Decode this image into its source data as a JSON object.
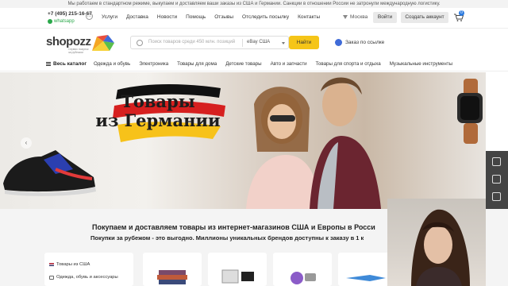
{
  "notice": "Мы работаем в стандартном режиме, выкупаем и доставляем ваши заказы из США и Германии. Санкции в отношении России не затронули международную логистику.",
  "contacts": {
    "phone": "+7 (495) 215-16-67",
    "whatsapp": "whatsapp"
  },
  "topnav": {
    "items": [
      "Услуги",
      "Доставка",
      "Новости",
      "Помощь",
      "Отзывы",
      "Отследить посылку",
      "Контакты"
    ],
    "location": "Москва",
    "login": "Войти",
    "register": "Создать аккаунт",
    "cart_count": "0"
  },
  "header": {
    "logo": "shopozz",
    "tagline": "Сервис покупок за рубежом",
    "search_placeholder": "Поиск товаров среди 450 млн. позиций",
    "search_source": "eBay США",
    "search_button": "Найти",
    "order_link": "Заказ по ссылке"
  },
  "catbar": {
    "all": "Весь каталог",
    "items": [
      "Одежда и обувь",
      "Электроника",
      "Товары для дома",
      "Детские товары",
      "Авто и запчасти",
      "Товары для спорта и отдыха",
      "Музыкальные инструменты"
    ]
  },
  "hero": {
    "line1": "Товары",
    "line2": "из Германии"
  },
  "section": {
    "title": "Покупаем и доставляем товары из интернет-магазинов США и Европы в Росси",
    "subtitle": "Покупки за рубежом - это выгодно. Миллионы уникальных брендов доступны к заказу в 1 к"
  },
  "leftmenu": {
    "items": [
      "Товары из США",
      "Одежда, обувь и аксессуары"
    ]
  },
  "colors": {
    "accent": "#f5c518",
    "link": "#3f6bd8",
    "badge": "#2d7be0",
    "whatsapp": "#2aa84a"
  },
  "icons": [
    "chat-icon",
    "location-pin-icon",
    "cart-icon",
    "search-icon",
    "order-link-icon",
    "burger-icon",
    "arrow-left-icon",
    "us-flag-icon",
    "clothes-icon"
  ]
}
